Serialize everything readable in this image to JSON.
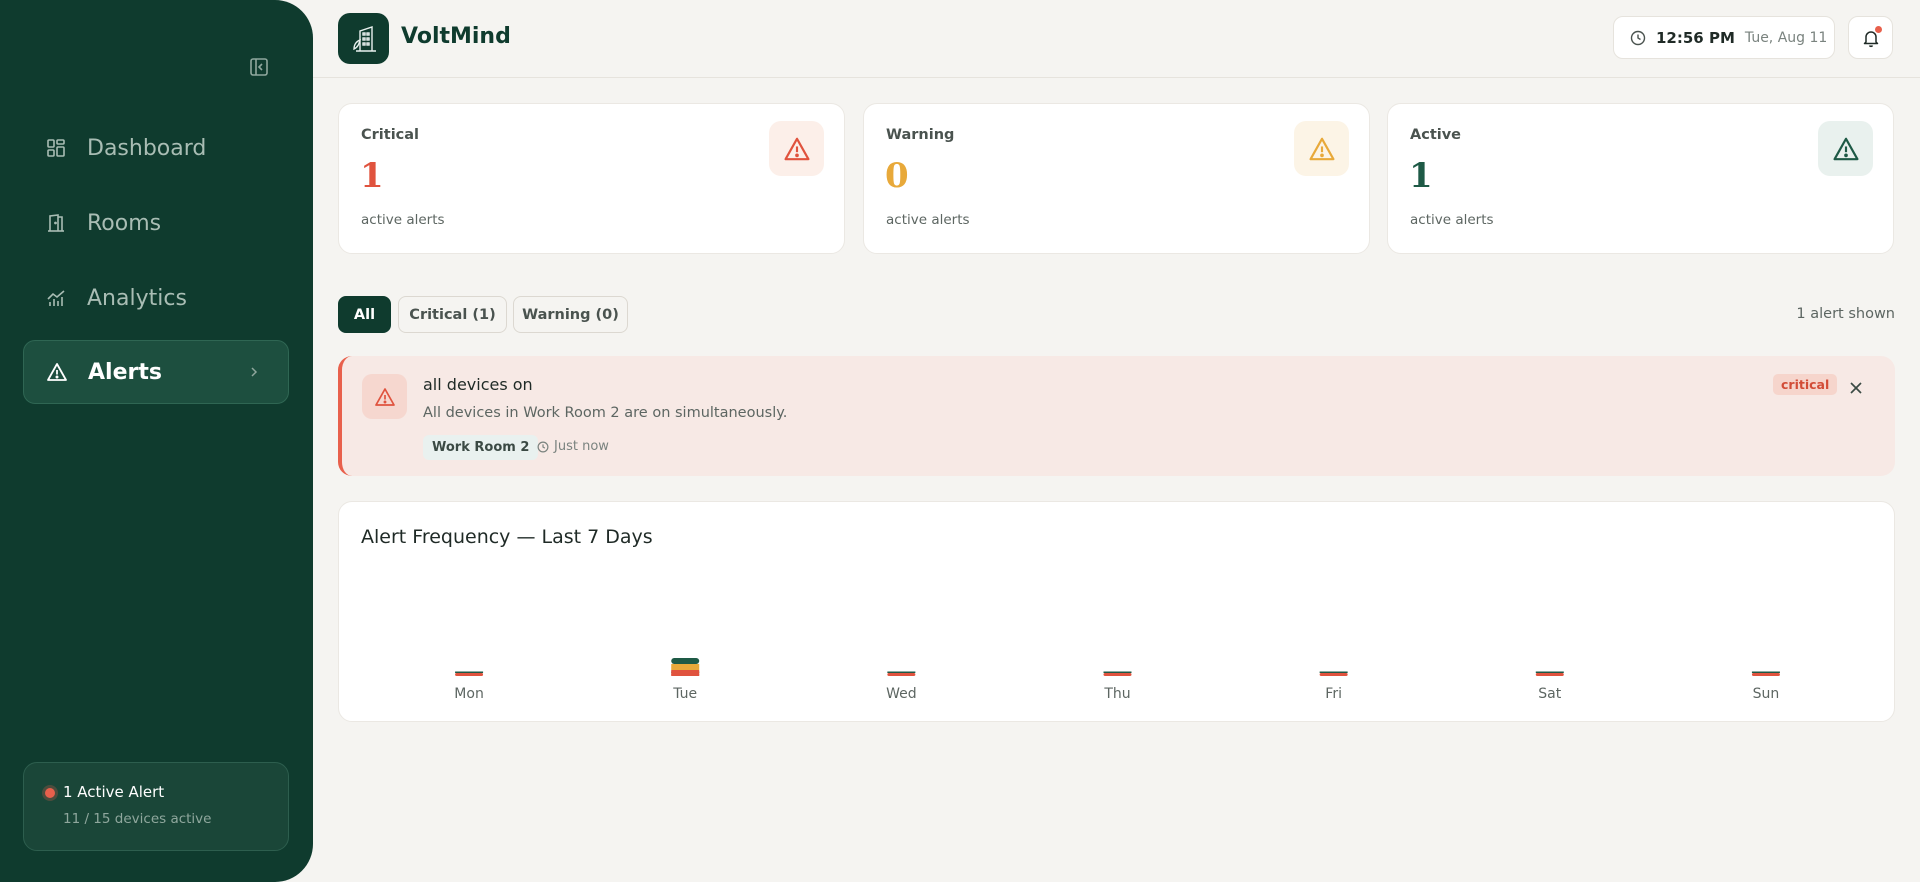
{
  "sidebar": {
    "items": [
      {
        "id": "dashboard",
        "label": "Dashboard",
        "icon": "grid-icon"
      },
      {
        "id": "rooms",
        "label": "Rooms",
        "icon": "door-icon"
      },
      {
        "id": "analytics",
        "label": "Analytics",
        "icon": "chart-icon"
      },
      {
        "id": "alerts",
        "label": "Alerts",
        "icon": "alert-triangle-icon",
        "active": true
      }
    ],
    "status": {
      "title": "1 Active Alert",
      "subtitle": "11 / 15 devices active"
    }
  },
  "header": {
    "brand": "VoltMind",
    "time": "12:56 PM",
    "date": "Tue, Aug 11"
  },
  "summary": {
    "critical": {
      "label": "Critical",
      "value": "1",
      "sub": "active alerts",
      "color": "#e0533e"
    },
    "warning": {
      "label": "Warning",
      "value": "0",
      "sub": "active alerts",
      "color": "#e8a93a"
    },
    "active": {
      "label": "Active",
      "value": "1",
      "sub": "active alerts",
      "color": "#1e5a46"
    }
  },
  "filters": {
    "all": "All",
    "critical": "Critical (1)",
    "warning": "Warning (0)",
    "shown": "1 alert shown"
  },
  "alert": {
    "title": "all devices on",
    "description": "All devices in Work Room 2 are on simultaneously.",
    "room": "Work Room 2",
    "time": "Just now",
    "severity": "critical"
  },
  "chart": {
    "title": "Alert Frequency — Last 7 Days"
  },
  "chart_data": {
    "type": "bar",
    "title": "Alert Frequency — Last 7 Days",
    "categories": [
      "Mon",
      "Tue",
      "Wed",
      "Thu",
      "Fri",
      "Sat",
      "Sun"
    ],
    "series": [
      {
        "values": [
          0,
          1,
          0,
          0,
          0,
          0,
          0
        ],
        "color": "#e0533e"
      },
      {
        "values": [
          0,
          1,
          0,
          0,
          0,
          0,
          0
        ],
        "color": "#e8a93a"
      },
      {
        "values": [
          0,
          1,
          0,
          0,
          0,
          0,
          0
        ],
        "color": "#1e5a46"
      }
    ],
    "stacked": true,
    "grid": false,
    "legend": "none"
  },
  "colors": {
    "sidebar": "#0f3b2e",
    "accent": "#0f3b2e",
    "critical": "#e0533e",
    "warning": "#e8a93a",
    "active": "#1e5a46"
  }
}
